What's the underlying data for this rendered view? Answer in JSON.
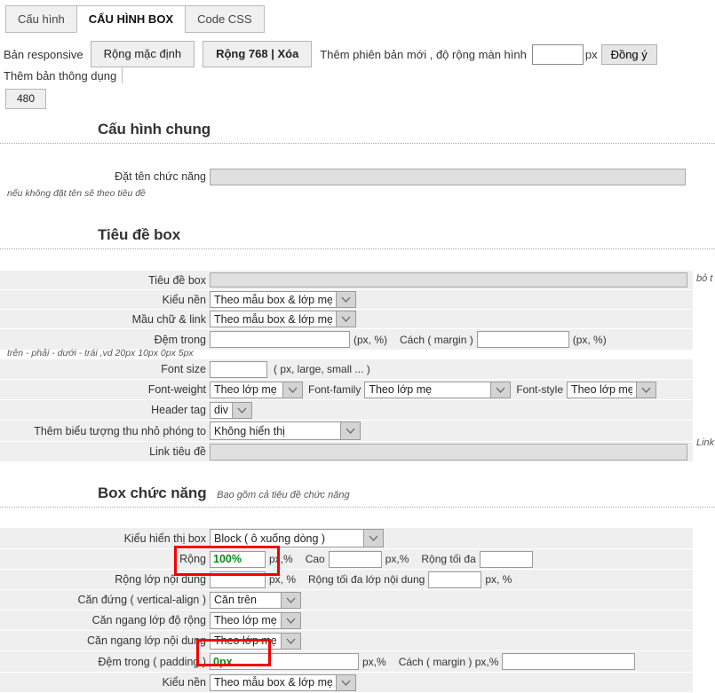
{
  "tabs": [
    {
      "label": "Cấu hình",
      "active": false
    },
    {
      "label": "CẤU HÌNH BOX",
      "active": true
    },
    {
      "label": "Code CSS",
      "active": false
    }
  ],
  "toolbar": {
    "responsive_label": "Bản responsive",
    "btn_default_width": "Rộng mặc định",
    "btn_width_768": "Rộng 768 | Xóa",
    "add_version_text": "Thêm phiên bản mới , độ rộng màn hình",
    "width_input_value": "",
    "px_unit": "px",
    "btn_agree": "Đồng ý",
    "add_common_text": "Thêm bản thông dụng",
    "btn_480": "480"
  },
  "sections": {
    "general": {
      "title": "Cấu hình chung"
    },
    "boxtitle": {
      "title": "Tiêu đề box"
    },
    "boxfunc": {
      "title": "Box chức năng",
      "note": "Bao gồm cả tiêu đề chức năng"
    }
  },
  "general_rows": {
    "name_label": "Đặt tên chức năng",
    "name_value": "",
    "name_hint": "nếu không đặt tên sẽ theo tiêu đề"
  },
  "boxtitle_rows": {
    "title_label": "Tiêu đề box",
    "title_value": "",
    "title_right_note": "bỏ t",
    "bg_label": "Kiểu nền",
    "bg_value": "Theo mẫu box & lớp mẹ",
    "color_label": "Mầu chữ & link",
    "color_value": "Theo mẫu box & lớp mẹ",
    "padding_label": "Đệm trong",
    "padding_value": "",
    "padding_unit": "(px, %)",
    "margin_label": "Cách ( margin )",
    "margin_value": "",
    "margin_unit": "(px, %)",
    "padding_hint": "trên - phải - dưới - trái ,vd  20px  10px  0px  5px",
    "fontsize_label": "Font size",
    "fontsize_value": "",
    "fontsize_unit": "( px, large, small ... )",
    "fontweight_label": "Font-weight",
    "fontweight_value": "Theo lớp mẹ",
    "fontfamily_label": "Font-family",
    "fontfamily_value": "Theo lớp mẹ",
    "fontstyle_label": "Font-style",
    "fontstyle_value": "Theo lớp mẹ",
    "headertag_label": "Header tag",
    "headertag_value": "div",
    "zoomicon_label": "Thêm biểu tượng thu nhỏ phóng to",
    "zoomicon_value": "Không hiển thị",
    "link_label": "Link tiêu đề",
    "link_value": "",
    "link_right_note": "Link"
  },
  "boxfunc_rows": {
    "display_label": "Kiểu hiển thị box",
    "display_value": "Block ( ô xuống dòng )",
    "width_label": "Rộng",
    "width_value": "100%",
    "width_unit": "px,%",
    "height_label": "Cao",
    "height_value": "",
    "height_unit": "px,%",
    "maxwidth_label": "Rộng tối đa",
    "maxwidth_value": "",
    "innerwidth_label": "Rộng lớp nội dung",
    "innerwidth_value": "",
    "innerwidth_unit": "px, %",
    "innermax_label": "Rộng tối đa lớp nội dung",
    "innermax_value": "",
    "innermax_unit": "px, %",
    "valign_label": "Căn đứng ( vertical-align )",
    "valign_value": "Căn trên",
    "halign_width_label": "Căn ngang lớp độ rộng",
    "halign_width_value": "Theo lớp mẹ",
    "halign_content_label": "Căn ngang lớp nội dung",
    "halign_content_value": "Theo lớp mẹ",
    "padding_label": "Đệm trong ( padding )",
    "padding_value": "0px",
    "padding_unit": "px,%",
    "margin_label": "Cách ( margin ) px,%",
    "margin_value": "",
    "bg_label": "Kiểu nền",
    "bg_value": "Theo mẫu box & lớp mẹ"
  },
  "colors": {
    "highlight": "#f30000",
    "green_value": "#0a8a19",
    "row_stripe": "#efefef"
  }
}
